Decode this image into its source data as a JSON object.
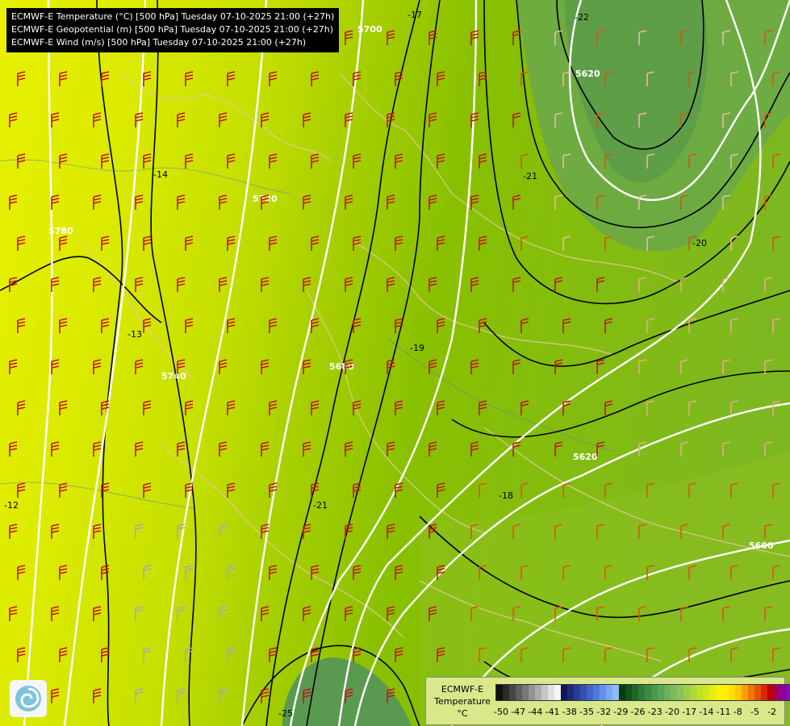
{
  "title_lines": [
    "ECMWF-E Temperature (°C) [500 hPa] Tuesday 07-10-2025 21:00 (+27h)",
    "ECMWF-E Geopotential (m) [500 hPa] Tuesday 07-10-2025 21:00 (+27h)",
    "ECMWF-E Wind (m/s) [500 hPa] Tuesday 07-10-2025 21:00 (+27h)"
  ],
  "map_labels": {
    "temp_contours": [
      "-17",
      "-22",
      "-14",
      "-13",
      "-12",
      "-19",
      "-18",
      "-20",
      "-21",
      "-21",
      "-25"
    ],
    "geo_contours": [
      "5700",
      "5720",
      "5780",
      "5740",
      "5680",
      "5620",
      "5620",
      "5600"
    ]
  },
  "legend": {
    "model": "ECMWF-E",
    "variable": "Temperature",
    "unit": "°C",
    "ticks": [
      "-50",
      "-47",
      "-44",
      "-41",
      "-38",
      "-35",
      "-32",
      "-29",
      "-26",
      "-23",
      "-20",
      "-17",
      "-14",
      "-11",
      "-8",
      "-5",
      "-2"
    ],
    "colors": [
      "#101010",
      "#2a2a2a",
      "#444444",
      "#5e5e5e",
      "#787878",
      "#929292",
      "#acacac",
      "#c6c6c6",
      "#e0e0e0",
      "#f4f4f4",
      "#14145a",
      "#1e2a78",
      "#283c96",
      "#3250b0",
      "#4064c8",
      "#5078dc",
      "#6490ec",
      "#7aa6f4",
      "#90bcf8",
      "#0c3a0c",
      "#14501a",
      "#1e6628",
      "#2a7c36",
      "#3a8a40",
      "#4a984a",
      "#5aa654",
      "#6ab25a",
      "#7abc5a",
      "#8ac45a",
      "#9cce4a",
      "#aed83a",
      "#c0e02a",
      "#d2e81a",
      "#e4ee10",
      "#f4f408",
      "#fff000",
      "#ffe000",
      "#ffc800",
      "#f8a000",
      "#f07800",
      "#e85000",
      "#d82800",
      "#c00000",
      "#a00060",
      "#9000a0",
      "#8010c0",
      "#7020d0",
      "#6030e0"
    ]
  }
}
